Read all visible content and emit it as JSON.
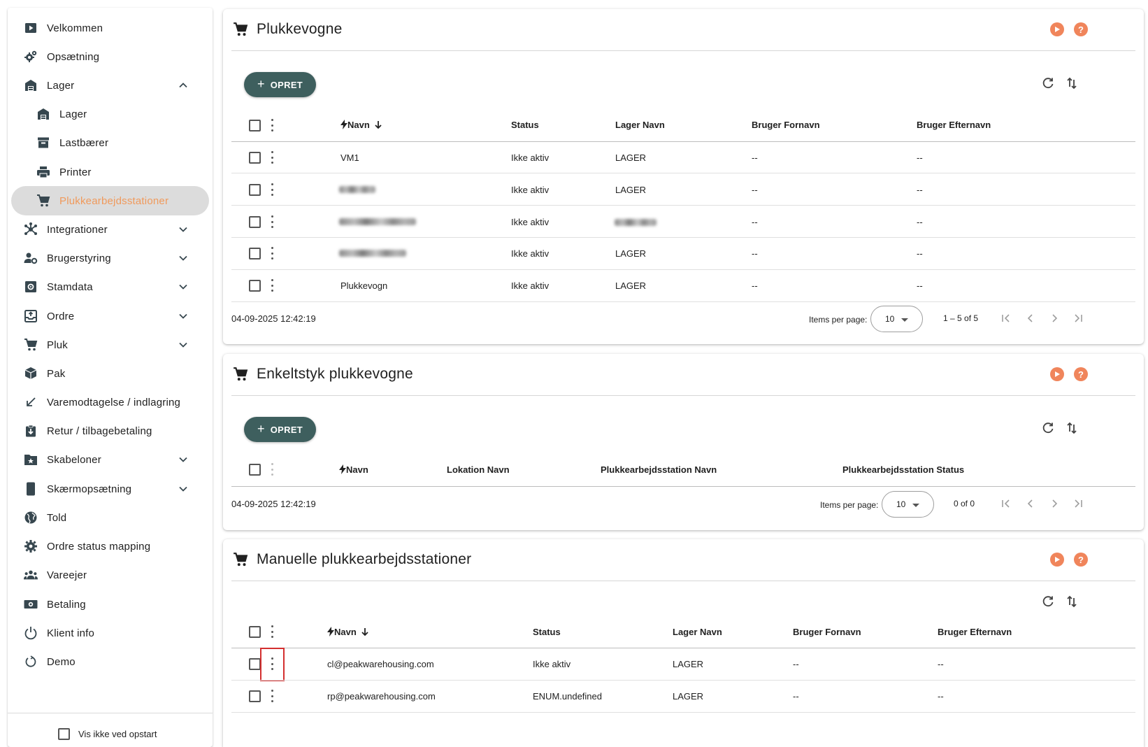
{
  "sidebar": {
    "items": [
      {
        "label": "Velkommen",
        "icon": "play-box-icon"
      },
      {
        "label": "Opsætning",
        "icon": "cogs-icon"
      },
      {
        "label": "Lager",
        "icon": "warehouse-icon",
        "expanded": true
      },
      {
        "label": "Lager",
        "icon": "warehouse-icon",
        "sub": true
      },
      {
        "label": "Lastbærer",
        "icon": "archive-icon",
        "sub": true
      },
      {
        "label": "Printer",
        "icon": "printer-icon",
        "sub": true
      },
      {
        "label": "Plukkearbejdsstationer",
        "icon": "cart-icon",
        "sub": true,
        "active": true
      },
      {
        "label": "Integrationer",
        "icon": "hub-icon",
        "expandable": true
      },
      {
        "label": "Brugerstyring",
        "icon": "user-cog-icon",
        "expandable": true
      },
      {
        "label": "Stamdata",
        "icon": "settings-box-icon",
        "expandable": true
      },
      {
        "label": "Ordre",
        "icon": "inbox-arrow-icon",
        "expandable": true
      },
      {
        "label": "Pluk",
        "icon": "cart-icon",
        "expandable": true
      },
      {
        "label": "Pak",
        "icon": "package-icon"
      },
      {
        "label": "Varemodtagelse / indlagring",
        "icon": "arrow-bottom-left-icon"
      },
      {
        "label": "Retur / tilbagebetaling",
        "icon": "clipboard-arrow-down-icon"
      },
      {
        "label": "Skabeloner",
        "icon": "folder-star-icon",
        "expandable": true
      },
      {
        "label": "Skærmopsætning",
        "icon": "cellphone-icon",
        "expandable": true
      },
      {
        "label": "Told",
        "icon": "globe-icon"
      },
      {
        "label": "Ordre status mapping",
        "icon": "cog-icon"
      },
      {
        "label": "Vareejer",
        "icon": "account-group-icon"
      },
      {
        "label": "Betaling",
        "icon": "cash-icon"
      },
      {
        "label": "Klient info",
        "icon": "power-icon"
      },
      {
        "label": "Demo",
        "icon": "restart-icon"
      }
    ],
    "startup_label": "Vis ikke ved opstart"
  },
  "colors": {
    "accent": "#f09a5c",
    "primary_button": "#3e5f5e",
    "help": "#f0855b"
  },
  "cards": {
    "plukkevogne": {
      "title": "Plukkevogne",
      "create_label": "OPRET",
      "columns": [
        "Navn",
        "Status",
        "Lager Navn",
        "Bruger Fornavn",
        "Bruger Efternavn"
      ],
      "rows": [
        {
          "navn": "VM1",
          "status": "Ikke aktiv",
          "lager": "LAGER",
          "fornavn": "--",
          "efternavn": "--"
        },
        {
          "navn": "",
          "status": "Ikke aktiv",
          "lager": "LAGER",
          "fornavn": "--",
          "efternavn": "--"
        },
        {
          "navn": "",
          "status": "Ikke aktiv",
          "lager": "",
          "fornavn": "--",
          "efternavn": "--"
        },
        {
          "navn": "",
          "status": "Ikke aktiv",
          "lager": "LAGER",
          "fornavn": "--",
          "efternavn": "--"
        },
        {
          "navn": "Plukkevogn",
          "status": "Ikke aktiv",
          "lager": "LAGER",
          "fornavn": "--",
          "efternavn": "--"
        }
      ],
      "timestamp": "04-09-2025 12:42:19",
      "items_per_page_label": "Items per page:",
      "items_per_page": "10",
      "range": "1 – 5 of 5"
    },
    "enkeltstyk": {
      "title": "Enkeltstyk plukkevogne",
      "create_label": "OPRET",
      "columns": [
        "Navn",
        "Lokation Navn",
        "Plukkearbejdsstation Navn",
        "Plukkearbejdsstation Status"
      ],
      "timestamp": "04-09-2025 12:42:19",
      "items_per_page_label": "Items per page:",
      "items_per_page": "10",
      "range": "0 of 0"
    },
    "manuelle": {
      "title": "Manuelle plukkearbejdsstationer",
      "columns": [
        "Navn",
        "Status",
        "Lager Navn",
        "Bruger Fornavn",
        "Bruger Efternavn"
      ],
      "rows": [
        {
          "navn": "cl@peakwarehousing.com",
          "status": "Ikke aktiv",
          "lager": "LAGER",
          "fornavn": "--",
          "efternavn": "--"
        },
        {
          "navn": "rp@peakwarehousing.com",
          "status": "ENUM.undefined",
          "lager": "LAGER",
          "fornavn": "--",
          "efternavn": "--"
        }
      ]
    }
  }
}
